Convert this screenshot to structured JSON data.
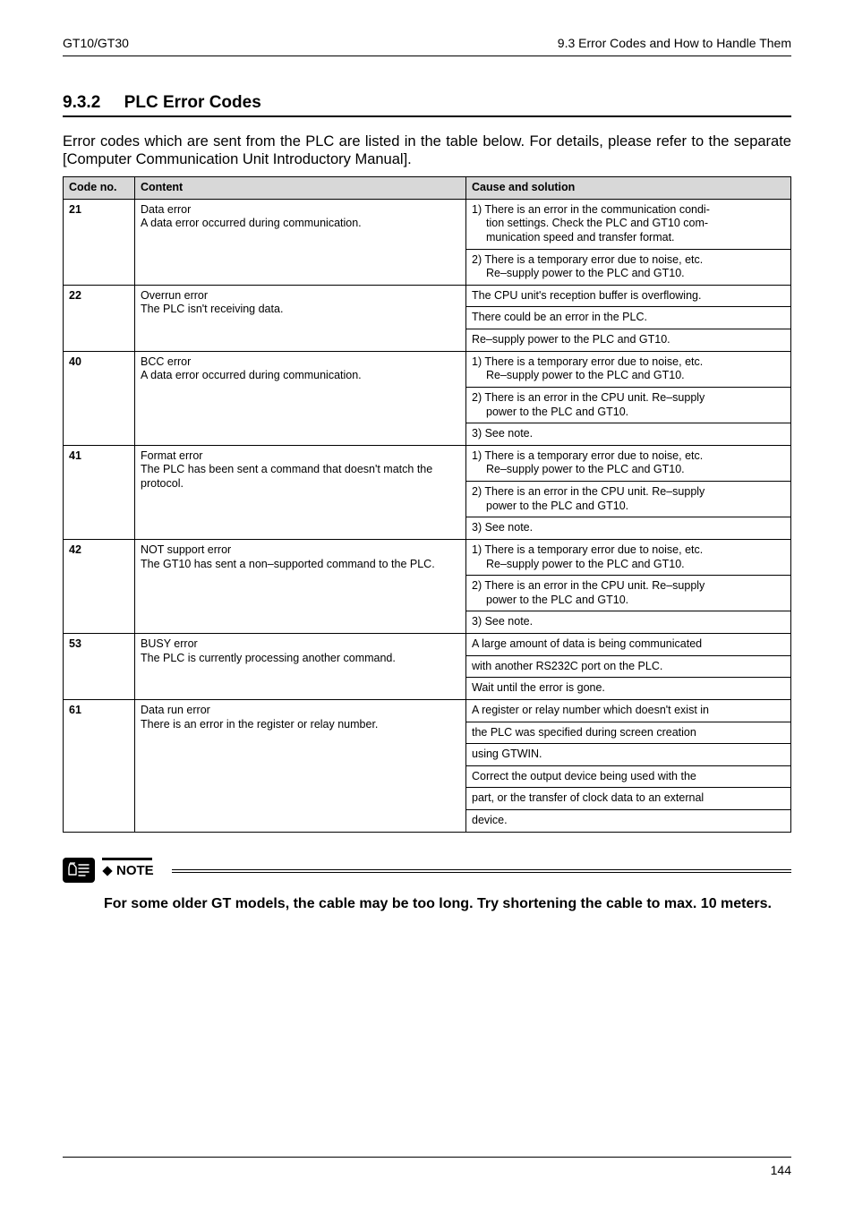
{
  "header": {
    "left": "GT10/GT30",
    "right": "9.3   Error Codes and How to Handle Them"
  },
  "section": {
    "number": "9.3.2",
    "title": "PLC Error Codes"
  },
  "intro": "Error codes which are sent from the PLC are listed in the table below. For details, please refer to the separate [Computer Communication Unit Introductory Manual].",
  "table": {
    "headers": {
      "code": "Code no.",
      "content": "Content",
      "cause": "Cause and solution"
    },
    "rows": [
      {
        "code": "21",
        "content_title": "Data error",
        "content_body": "A data error occurred during communication.",
        "solutions": [
          {
            "lead": "1) There is an error in the communication condi-",
            "cont": [
              "tion settings. Check the PLC and GT10 com-",
              "munication speed and transfer format."
            ]
          },
          {
            "lead": "2) There is a temporary error due to noise, etc.",
            "cont": [
              "Re–supply power to the PLC and GT10."
            ]
          }
        ]
      },
      {
        "code": "22",
        "content_title": "Overrun error",
        "content_body": "The PLC isn't receiving data.",
        "solutions": [
          {
            "lead": "The CPU unit's reception buffer is overflowing.",
            "cont": []
          },
          {
            "lead": "There could be an error in the PLC.",
            "cont": []
          },
          {
            "lead": "Re–supply power to the PLC and GT10.",
            "cont": []
          }
        ]
      },
      {
        "code": "40",
        "content_title": "BCC error",
        "content_body": "A data error occurred during communication.",
        "solutions": [
          {
            "lead": "1) There is a temporary error due to noise, etc.",
            "cont": [
              "Re–supply power to the PLC and GT10."
            ]
          },
          {
            "lead": "2) There is an error in the CPU unit. Re–supply",
            "cont": [
              "power to the PLC and GT10."
            ]
          },
          {
            "lead": "3) See note.",
            "cont": []
          }
        ]
      },
      {
        "code": "41",
        "content_title": "Format error",
        "content_body": "The PLC has been sent a command that doesn't match the protocol.",
        "solutions": [
          {
            "lead": "1) There is a temporary error due to noise, etc.",
            "cont": [
              "Re–supply power to the PLC and GT10."
            ]
          },
          {
            "lead": "2) There is an error in the CPU unit. Re–supply",
            "cont": [
              "power to the PLC and GT10."
            ]
          },
          {
            "lead": "3) See note.",
            "cont": []
          }
        ]
      },
      {
        "code": "42",
        "content_title": "NOT support error",
        "content_body": "The GT10 has sent a non–supported command to the PLC.",
        "solutions": [
          {
            "lead": "1) There is a temporary error due to noise, etc.",
            "cont": [
              "Re–supply power to the PLC and GT10."
            ]
          },
          {
            "lead": "2) There is an error in the CPU unit. Re–supply",
            "cont": [
              "power to the PLC and GT10."
            ]
          },
          {
            "lead": "3) See note.",
            "cont": []
          }
        ]
      },
      {
        "code": "53",
        "content_title": "BUSY error",
        "content_body": "The PLC is currently processing another command.",
        "solutions": [
          {
            "lead": "A large amount of data is being communicated",
            "cont": []
          },
          {
            "lead": "with another RS232C port on the PLC.",
            "cont": []
          },
          {
            "lead": "Wait until the error is gone.",
            "cont": []
          }
        ]
      },
      {
        "code": "61",
        "content_title": "Data run error",
        "content_body": "There is an error in the register or relay number.",
        "solutions": [
          {
            "lead": "A register or relay number which doesn't exist in",
            "cont": []
          },
          {
            "lead": "the PLC was specified during screen creation",
            "cont": []
          },
          {
            "lead": "using GTWIN.",
            "cont": []
          },
          {
            "lead": "Correct the output device being used with the",
            "cont": []
          },
          {
            "lead": "part, or the transfer of clock data to an external",
            "cont": []
          },
          {
            "lead": "device.",
            "cont": []
          }
        ]
      }
    ]
  },
  "note": {
    "label": "NOTE",
    "text": "For some older GT models, the cable may be too long. Try shortening the cable to max. 10 meters."
  },
  "footer": {
    "page": "144"
  }
}
